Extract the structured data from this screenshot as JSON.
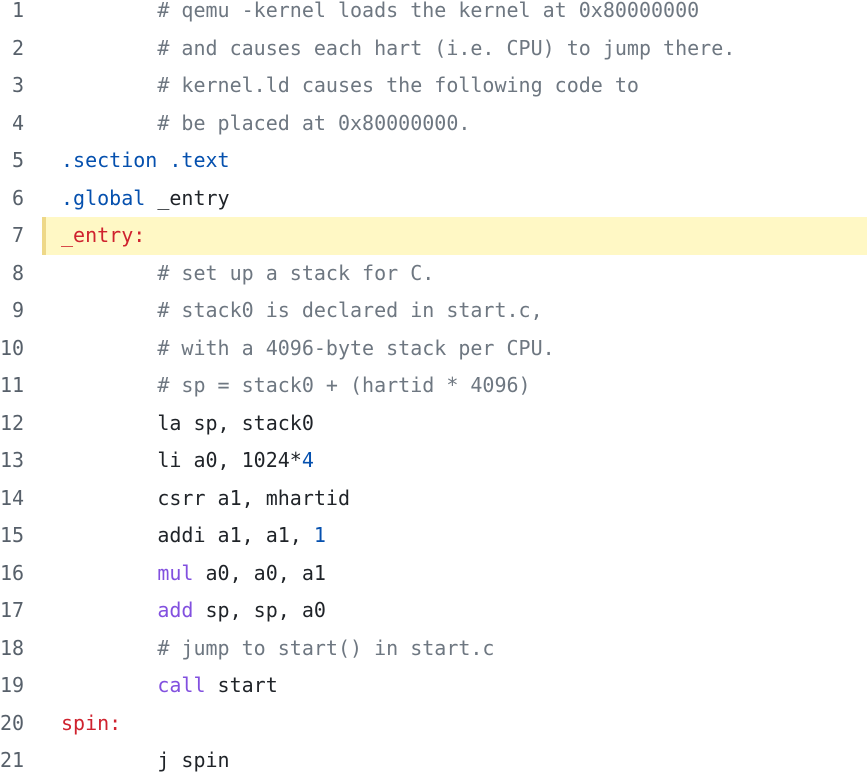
{
  "highlighted_line": 7,
  "colors": {
    "comment": "#6e7781",
    "directive": "#0550ae",
    "label": "#cf222e",
    "keyword": "#8250df",
    "number": "#0550ae",
    "highlight": "#fff8c5"
  },
  "lines": [
    {
      "n": "1",
      "tokens": [
        [
          "plain",
          "        "
        ],
        [
          "comment",
          "# qemu -kernel loads the kernel at 0x80000000"
        ]
      ]
    },
    {
      "n": "2",
      "tokens": [
        [
          "plain",
          "        "
        ],
        [
          "comment",
          "# and causes each hart (i.e. CPU) to jump there."
        ]
      ]
    },
    {
      "n": "3",
      "tokens": [
        [
          "plain",
          "        "
        ],
        [
          "comment",
          "# kernel.ld causes the following code to"
        ]
      ]
    },
    {
      "n": "4",
      "tokens": [
        [
          "plain",
          "        "
        ],
        [
          "comment",
          "# be placed at 0x80000000."
        ]
      ]
    },
    {
      "n": "5",
      "tokens": [
        [
          "directive",
          ".section"
        ],
        [
          "plain",
          " "
        ],
        [
          "directive",
          ".text"
        ]
      ]
    },
    {
      "n": "6",
      "tokens": [
        [
          "directive",
          ".global"
        ],
        [
          "plain",
          " _entry"
        ]
      ]
    },
    {
      "n": "7",
      "tokens": [
        [
          "label",
          "_entry:"
        ]
      ]
    },
    {
      "n": "8",
      "tokens": [
        [
          "plain",
          "        "
        ],
        [
          "comment",
          "# set up a stack for C."
        ]
      ]
    },
    {
      "n": "9",
      "tokens": [
        [
          "plain",
          "        "
        ],
        [
          "comment",
          "# stack0 is declared in start.c,"
        ]
      ]
    },
    {
      "n": "10",
      "tokens": [
        [
          "plain",
          "        "
        ],
        [
          "comment",
          "# with a 4096-byte stack per CPU."
        ]
      ]
    },
    {
      "n": "11",
      "tokens": [
        [
          "plain",
          "        "
        ],
        [
          "comment",
          "# sp = stack0 + (hartid * 4096)"
        ]
      ]
    },
    {
      "n": "12",
      "tokens": [
        [
          "plain",
          "        la sp, stack0"
        ]
      ]
    },
    {
      "n": "13",
      "tokens": [
        [
          "plain",
          "        li a0, 1024*"
        ],
        [
          "number",
          "4"
        ]
      ]
    },
    {
      "n": "14",
      "tokens": [
        [
          "plain",
          "        csrr a1, mhartid"
        ]
      ]
    },
    {
      "n": "15",
      "tokens": [
        [
          "plain",
          "        addi a1, a1, "
        ],
        [
          "number",
          "1"
        ]
      ]
    },
    {
      "n": "16",
      "tokens": [
        [
          "plain",
          "        "
        ],
        [
          "keyword",
          "mul"
        ],
        [
          "plain",
          " a0, a0, a1"
        ]
      ]
    },
    {
      "n": "17",
      "tokens": [
        [
          "plain",
          "        "
        ],
        [
          "keyword",
          "add"
        ],
        [
          "plain",
          " sp, sp, a0"
        ]
      ]
    },
    {
      "n": "18",
      "tokens": [
        [
          "plain",
          "        "
        ],
        [
          "comment",
          "# jump to start() in start.c"
        ]
      ]
    },
    {
      "n": "19",
      "tokens": [
        [
          "plain",
          "        "
        ],
        [
          "keyword",
          "call"
        ],
        [
          "plain",
          " start"
        ]
      ]
    },
    {
      "n": "20",
      "tokens": [
        [
          "label",
          "spin:"
        ]
      ]
    },
    {
      "n": "21",
      "tokens": [
        [
          "plain",
          "        j spin"
        ]
      ]
    }
  ]
}
